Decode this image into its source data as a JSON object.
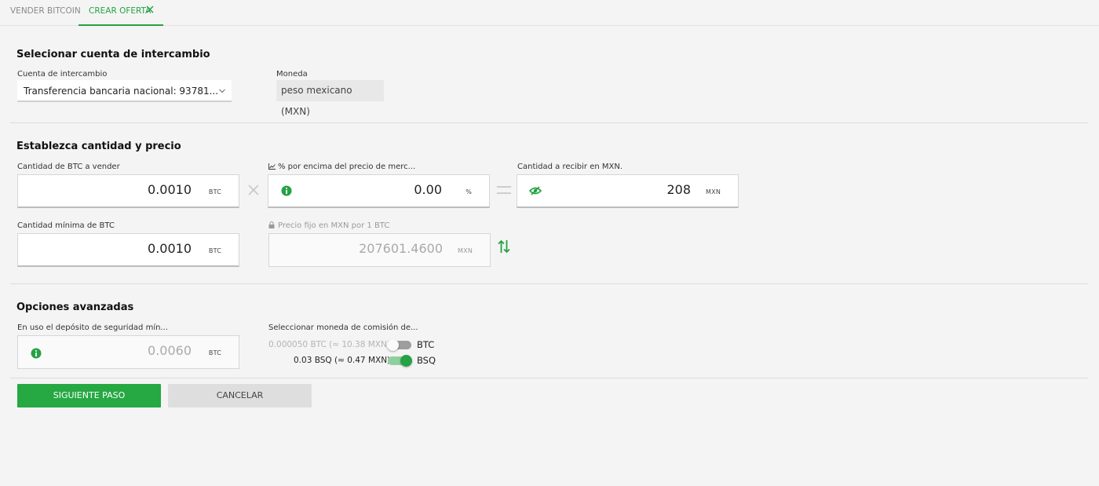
{
  "tabs": [
    {
      "label": "VENDER BITCOIN"
    },
    {
      "label": "CREAR OFERTA"
    }
  ],
  "account_section": {
    "title": "Selecionar cuenta de intercambio",
    "account_label": "Cuenta de intercambio",
    "account_value": "Transferencia bancaria nacional: 93781...",
    "currency_label": "Moneda",
    "currency_value": "peso mexicano (MXN)"
  },
  "amount_section": {
    "title": "Establezca cantidad y precio",
    "btc_amount_label": "Cantidad de BTC a vender",
    "btc_amount_value": "0.0010",
    "btc_amount_unit": "BTC",
    "market_pct_label": "% por encima del precio de merc...",
    "market_pct_value": "0.00",
    "market_pct_unit": "%",
    "receive_label": "Cantidad a recibir en MXN.",
    "receive_value": "208",
    "receive_unit": "MXN",
    "min_btc_label": "Cantidad mínima de BTC",
    "min_btc_value": "0.0010",
    "min_btc_unit": "BTC",
    "fixed_price_label": "Precio fijo en MXN por 1 BTC",
    "fixed_price_value": "207601.4600",
    "fixed_price_unit": "MXN"
  },
  "advanced_section": {
    "title": "Opciones avanzadas",
    "deposit_label": "En uso el depósito de seguridad mín...",
    "deposit_value": "0.0060",
    "deposit_unit": "BTC",
    "fee_label": "Seleccionar moneda de comisión de...",
    "fee_options": [
      {
        "amount": "0.000050 BTC (≈ 10.38 MXN)",
        "currency": "BTC",
        "selected": false
      },
      {
        "amount": "0.03 BSQ (≈ 0.47 MXN)",
        "currency": "BSQ",
        "selected": true
      }
    ]
  },
  "buttons": {
    "next": "SIGUIENTE PASO",
    "cancel": "CANCELAR"
  },
  "colors": {
    "accent": "#25a244",
    "primary_button": "#26a843"
  }
}
